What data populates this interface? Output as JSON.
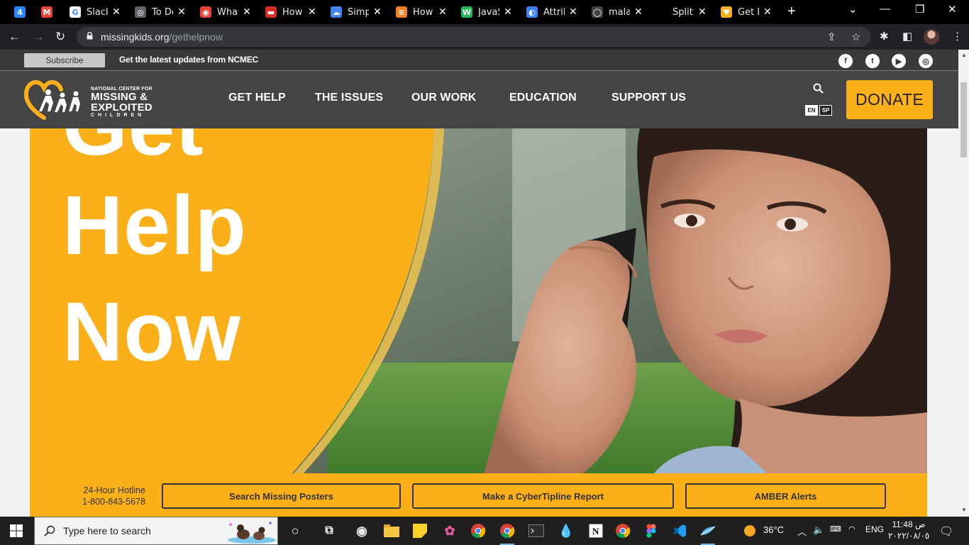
{
  "browser": {
    "tabs": [
      {
        "title": "",
        "favicon_color": "#2684fc",
        "favicon_text": "4",
        "icon": "calendar-icon"
      },
      {
        "title": "",
        "favicon_color": "#ea4335",
        "favicon_text": "M",
        "icon": "gmail-icon"
      },
      {
        "title": "Slack",
        "favicon_color": "#ffffff",
        "favicon_text": "G",
        "icon": "google-icon"
      },
      {
        "title": "To Do",
        "favicon_color": "#5f6368",
        "favicon_text": "◎",
        "icon": "globe-icon"
      },
      {
        "title": "What",
        "favicon_color": "#ea4335",
        "favicon_text": "◉",
        "icon": "chrome-icon"
      },
      {
        "title": "How",
        "favicon_color": "#d62d20",
        "favicon_text": "▬",
        "icon": "video-icon"
      },
      {
        "title": "Simp",
        "favicon_color": "#4285f4",
        "favicon_text": "☁",
        "icon": "cloud-icon"
      },
      {
        "title": "How",
        "favicon_color": "#f48024",
        "favicon_text": "≡",
        "icon": "stackoverflow-icon"
      },
      {
        "title": "JavaS",
        "favicon_color": "#1db954",
        "favicon_text": "W",
        "icon": "w3-icon"
      },
      {
        "title": "Attrib",
        "favicon_color": "#3b82f6",
        "favicon_text": "◐",
        "icon": "moon-icon"
      },
      {
        "title": "malak",
        "favicon_color": "#444444",
        "favicon_text": "◯",
        "icon": "github-icon"
      },
      {
        "title": "Splitt",
        "favicon_color": "#000000",
        "favicon_text": "",
        "icon": "blank-icon"
      },
      {
        "title": "Get H",
        "favicon_color": "#fbb019",
        "favicon_text": "♥",
        "icon": "ncmec-icon"
      }
    ],
    "new_tab": "+",
    "url_host": "missingkids.org",
    "url_path": "/gethelpnow"
  },
  "site": {
    "utility": {
      "subscribe": "Subscribe",
      "tagline": "Get the latest updates from NCMEC",
      "social": [
        {
          "icon": "facebook-icon",
          "glyph": "f"
        },
        {
          "icon": "twitter-icon",
          "glyph": "t"
        },
        {
          "icon": "youtube-icon",
          "glyph": "▶"
        },
        {
          "icon": "instagram-icon",
          "glyph": "◎"
        }
      ]
    },
    "logo": {
      "line1": "NATIONAL CENTER FOR",
      "line2": "MISSING &",
      "line3": "EXPLOITED",
      "line4": "CHILDREN"
    },
    "nav": [
      "GET HELP",
      "THE ISSUES",
      "OUR WORK",
      "EDUCATION",
      "SUPPORT US"
    ],
    "lang": {
      "en": "EN",
      "sp": "SP"
    },
    "donate": "DONATE",
    "hero": {
      "line1": "Get",
      "line2": "Help",
      "line3": "Now"
    },
    "hotline": {
      "label": "24-Hour Hotline",
      "number": "1-800-843-5678"
    },
    "quick_links": [
      "Search Missing Posters",
      "Make a CyberTipline Report",
      "AMBER Alerts"
    ],
    "colors": {
      "brand_yellow": "#fbb019",
      "nav_bg": "#444444",
      "utility_bg": "#3a3a3a"
    }
  },
  "taskbar": {
    "search_placeholder": "Type here to search",
    "weather": "36°C",
    "language": "ENG",
    "time": "11:48 ص",
    "date": "٢٠٢٢/٠٨/٠٥"
  }
}
